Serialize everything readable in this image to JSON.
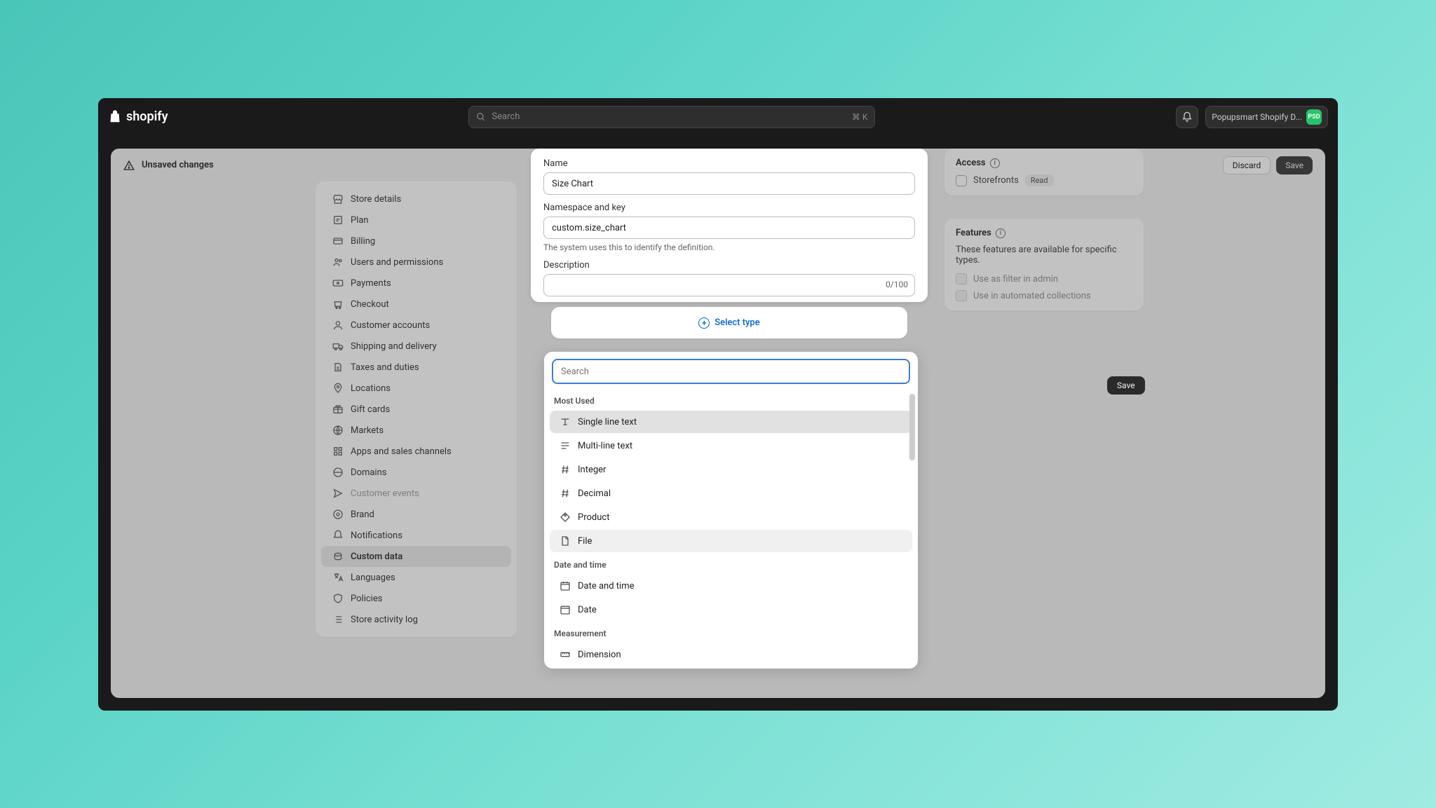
{
  "topbar": {
    "brand": "shopify",
    "search_placeholder": "Search",
    "search_kbd": "⌘ K",
    "account_name": "Popupsmart Shopify D...",
    "avatar_initials": "PSD"
  },
  "context": {
    "unsaved": "Unsaved changes",
    "discard": "Discard",
    "save": "Save"
  },
  "sidebar": {
    "items": [
      {
        "label": "Store details"
      },
      {
        "label": "Plan"
      },
      {
        "label": "Billing"
      },
      {
        "label": "Users and permissions"
      },
      {
        "label": "Payments"
      },
      {
        "label": "Checkout"
      },
      {
        "label": "Customer accounts"
      },
      {
        "label": "Shipping and delivery"
      },
      {
        "label": "Taxes and duties"
      },
      {
        "label": "Locations"
      },
      {
        "label": "Gift cards"
      },
      {
        "label": "Markets"
      },
      {
        "label": "Apps and sales channels"
      },
      {
        "label": "Domains"
      },
      {
        "label": "Customer events"
      },
      {
        "label": "Brand"
      },
      {
        "label": "Notifications"
      },
      {
        "label": "Custom data"
      },
      {
        "label": "Languages"
      },
      {
        "label": "Policies"
      },
      {
        "label": "Store activity log"
      }
    ]
  },
  "form": {
    "name_label": "Name",
    "name_value": "Size Chart",
    "namespace_label": "Namespace and key",
    "namespace_value": "custom.size_chart",
    "namespace_help": "The system uses this to identify the definition.",
    "description_label": "Description",
    "description_value": "",
    "description_count": "0/100",
    "select_type": "Select type"
  },
  "access": {
    "title": "Access",
    "storefronts": "Storefronts",
    "read_badge": "Read"
  },
  "features": {
    "title": "Features",
    "desc": "These features are available for specific types.",
    "opt1": "Use as filter in admin",
    "opt2": "Use in automated collections"
  },
  "save2": "Save",
  "dropdown": {
    "search_placeholder": "Search",
    "sections": {
      "most_used": "Most Used",
      "date_time": "Date and time",
      "measurement": "Measurement"
    },
    "items": {
      "single_line": "Single line text",
      "multi_line": "Multi-line text",
      "integer": "Integer",
      "decimal": "Decimal",
      "product": "Product",
      "file": "File",
      "datetime": "Date and time",
      "date": "Date",
      "dimension": "Dimension"
    }
  }
}
